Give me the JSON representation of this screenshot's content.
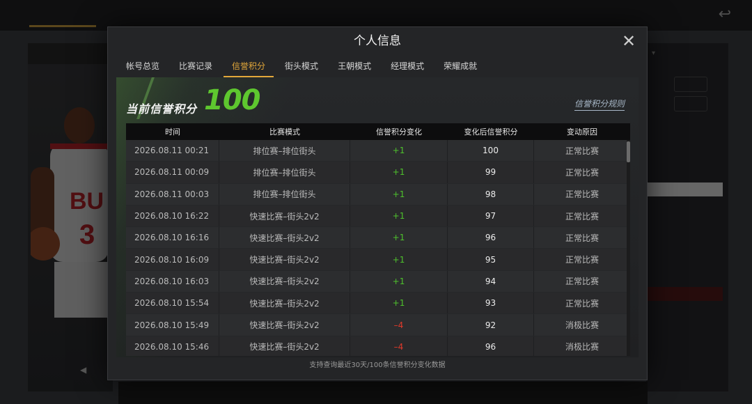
{
  "modal": {
    "title": "个人信息",
    "close_icon": "close-icon",
    "tabs": [
      {
        "label": "帐号总览",
        "active": false
      },
      {
        "label": "比赛记录",
        "active": false
      },
      {
        "label": "信誉积分",
        "active": true
      },
      {
        "label": "街头模式",
        "active": false
      },
      {
        "label": "王朝模式",
        "active": false
      },
      {
        "label": "经理模式",
        "active": false
      },
      {
        "label": "荣耀成就",
        "active": false
      }
    ]
  },
  "credit": {
    "label": "当前信誉积分",
    "value": "100",
    "rules_link": "信誉积分规则"
  },
  "table": {
    "headers": [
      "时间",
      "比赛模式",
      "信誉积分变化",
      "变化后信誉积分",
      "变动原因"
    ],
    "rows": [
      {
        "time": "2026.08.11  00:21",
        "mode": "排位赛–排位街头",
        "change": "+1",
        "after": "100",
        "reason": "正常比赛"
      },
      {
        "time": "2026.08.11  00:09",
        "mode": "排位赛–排位街头",
        "change": "+1",
        "after": "99",
        "reason": "正常比赛"
      },
      {
        "time": "2026.08.11  00:03",
        "mode": "排位赛–排位街头",
        "change": "+1",
        "after": "98",
        "reason": "正常比赛"
      },
      {
        "time": "2026.08.10  16:22",
        "mode": "快速比赛–街头2v2",
        "change": "+1",
        "after": "97",
        "reason": "正常比赛"
      },
      {
        "time": "2026.08.10  16:16",
        "mode": "快速比赛–街头2v2",
        "change": "+1",
        "after": "96",
        "reason": "正常比赛"
      },
      {
        "time": "2026.08.10  16:09",
        "mode": "快速比赛–街头2v2",
        "change": "+1",
        "after": "95",
        "reason": "正常比赛"
      },
      {
        "time": "2026.08.10  16:03",
        "mode": "快速比赛–街头2v2",
        "change": "+1",
        "after": "94",
        "reason": "正常比赛"
      },
      {
        "time": "2026.08.10  15:54",
        "mode": "快速比赛–街头2v2",
        "change": "+1",
        "after": "93",
        "reason": "正常比赛"
      },
      {
        "time": "2026.08.10  15:49",
        "mode": "快速比赛–街头2v2",
        "change": "–4",
        "after": "92",
        "reason": "消极比赛"
      },
      {
        "time": "2026.08.10  15:46",
        "mode": "快速比赛–街头2v2",
        "change": "–4",
        "after": "96",
        "reason": "消极比赛"
      }
    ]
  },
  "footnote": "支持查询最近30天/100条信誉积分变化数据",
  "colors": {
    "accent": "#e3a83a",
    "positive": "#4ec12c",
    "negative": "#e23a2a",
    "score": "#5ec72f"
  }
}
